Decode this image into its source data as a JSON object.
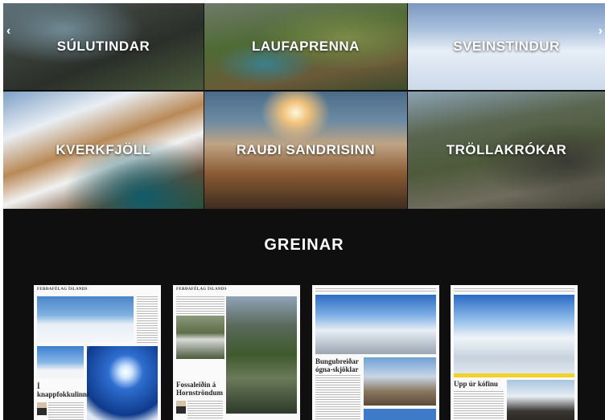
{
  "carousel": {
    "prev_icon": "‹",
    "next_icon": "›",
    "tiles": [
      {
        "label": "SÚLUTINDAR"
      },
      {
        "label": "LAUFAPRENNA"
      },
      {
        "label": "SVEINSTINDUR"
      },
      {
        "label": "KVERKFJÖLL"
      },
      {
        "label": "RAUÐI SANDRISINN"
      },
      {
        "label": "TRÖLLAKRÓKAR"
      }
    ]
  },
  "articles": {
    "title": "GREINAR",
    "items": [
      {
        "header": "FERÐAFÉLAG ÍSLANDS",
        "headline": "Í knappfokkulinni"
      },
      {
        "header": "FERÐAFÉLAG ÍSLANDS",
        "headline": "Fossaleiðin á Hornströndum"
      },
      {
        "header": "",
        "headline": "Bungubreiðar ógna-skjöklar"
      },
      {
        "header": "",
        "headline": "Upp úr kófinu"
      }
    ]
  },
  "colors": {
    "background": "#0f0f0f",
    "accent_band": "#f2d227"
  }
}
